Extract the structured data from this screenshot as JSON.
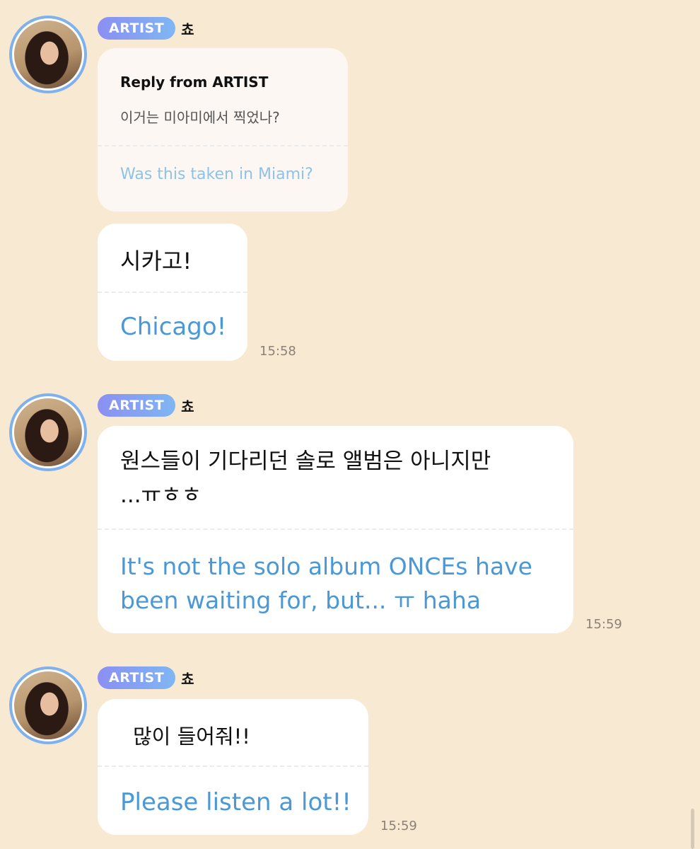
{
  "messages": [
    {
      "badge": "ARTIST",
      "name": "쵸",
      "reply": {
        "title": "Reply from ARTIST",
        "original_ko": "이거는 미아미에서 찍었나?",
        "original_en": "Was this taken in Miami?"
      },
      "text_ko": "시카고!",
      "text_en": "Chicago!",
      "time": "15:58"
    },
    {
      "badge": "ARTIST",
      "name": "쵸",
      "text_ko_lines": [
        "원스들이 기다리던 솔로 앨범은 아니지만",
        "...ㅠㅎㅎ"
      ],
      "text_en_lines": [
        "It's not the solo album ONCEs have",
        "been waiting for, but... ㅠ haha"
      ],
      "time": "15:59"
    },
    {
      "badge": "ARTIST",
      "name": "쵸",
      "text_ko": "많이 들어줘!!",
      "text_en": "Please listen a lot!!",
      "time": "15:59"
    }
  ]
}
